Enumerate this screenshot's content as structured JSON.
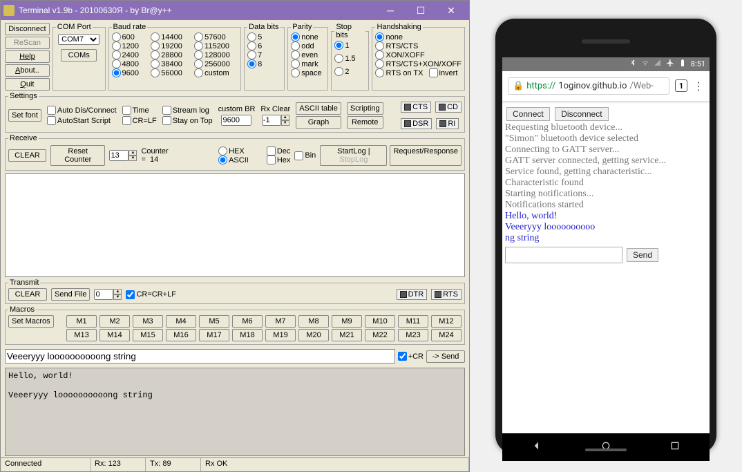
{
  "window": {
    "title": "Terminal v1.9b - 20100630Я - by Br@y++"
  },
  "sidebuttons": {
    "disconnect": "Disconnect",
    "rescan": "ReScan",
    "help": "Help",
    "about": "About..",
    "quit": "Quit"
  },
  "comport": {
    "legend": "COM Port",
    "selected": "COM7",
    "comsBtn": "COMs"
  },
  "baud": {
    "legend": "Baud rate",
    "options": [
      "600",
      "1200",
      "2400",
      "4800",
      "9600",
      "14400",
      "19200",
      "28800",
      "38400",
      "56000",
      "57600",
      "115200",
      "128000",
      "256000",
      "custom"
    ],
    "selected": "9600"
  },
  "databits": {
    "legend": "Data bits",
    "options": [
      "5",
      "6",
      "7",
      "8"
    ],
    "selected": "8"
  },
  "parity": {
    "legend": "Parity",
    "options": [
      "none",
      "odd",
      "even",
      "mark",
      "space"
    ],
    "selected": "none"
  },
  "stopbits": {
    "legend": "Stop bits",
    "options": [
      "1",
      "1.5",
      "2"
    ],
    "selected": "1"
  },
  "handshake": {
    "legend": "Handshaking",
    "options": [
      "none",
      "RTS/CTS",
      "XON/XOFF",
      "RTS/CTS+XON/XOFF",
      "RTS on TX"
    ],
    "selected": "none",
    "invert": "invert"
  },
  "settings": {
    "legend": "Settings",
    "setfont": "Set font",
    "autodis": "Auto Dis/Connect",
    "autostart": "AutoStart Script",
    "time": "Time",
    "crlf": "CR=LF",
    "streamlog": "Stream log",
    "stayontop": "Stay on Top",
    "custombr_label": "custom BR",
    "custombr_val": "9600",
    "rxclear_label": "Rx Clear",
    "rxclear_val": "-1",
    "ascii_table": "ASCII table",
    "graph": "Graph",
    "scripting": "Scripting",
    "remote": "Remote",
    "leds": {
      "cts": "CTS",
      "cd": "CD",
      "dsr": "DSR",
      "ri": "RI"
    }
  },
  "receive": {
    "legend": "Receive",
    "clear": "CLEAR",
    "reset": "Reset Counter",
    "reset_val": "13",
    "counter_label": "Counter =",
    "counter_val": "14",
    "hex": "HEX",
    "ascii": "ASCII",
    "dec": "Dec",
    "hex2": "Hex",
    "bin": "Bin",
    "startlog": "StartLog",
    "stoplog": "StopLog",
    "reqresp": "Request/Response"
  },
  "transmit": {
    "legend": "Transmit",
    "clear": "CLEAR",
    "sendfile": "Send File",
    "spin": "0",
    "crcrlf": "CR=CR+LF",
    "dtr": "DTR",
    "rts": "RTS"
  },
  "macros": {
    "legend": "Macros",
    "setmacros": "Set Macros",
    "row1": [
      "M1",
      "M2",
      "M3",
      "M4",
      "M5",
      "M6",
      "M7",
      "M8",
      "M9",
      "M10",
      "M11",
      "M12"
    ],
    "row2": [
      "M13",
      "M14",
      "M15",
      "M16",
      "M17",
      "M18",
      "M19",
      "M20",
      "M21",
      "M22",
      "M23",
      "M24"
    ]
  },
  "sendline": {
    "text": "Veeeryyy loooooooooong string",
    "cr": "+CR",
    "send": "-> Send"
  },
  "mono": "Hello, world!\n\nVeeeryyy loooooooooong string",
  "status": {
    "conn": "Connected",
    "rx": "Rx: 123",
    "tx": "Tx: 89",
    "ok": "Rx OK"
  },
  "phone": {
    "status_time": "8:51",
    "url_prefix": "https://",
    "url_host": "1oginov.github.io",
    "url_path": "/Web-",
    "tabs": "1",
    "connect": "Connect",
    "disconnect": "Disconnect",
    "log": [
      "Requesting bluetooth device...",
      "\"Simon\" bluetooth device selected",
      "Connecting to GATT server...",
      "GATT server connected, getting service...",
      "Service found, getting characteristic...",
      "Characteristic found",
      "Starting notifications...",
      "Notifications started"
    ],
    "blue1": "Hello, world!",
    "blue2": "Veeeryyy loooooooooo",
    "blue3": "ng string",
    "send": "Send"
  }
}
